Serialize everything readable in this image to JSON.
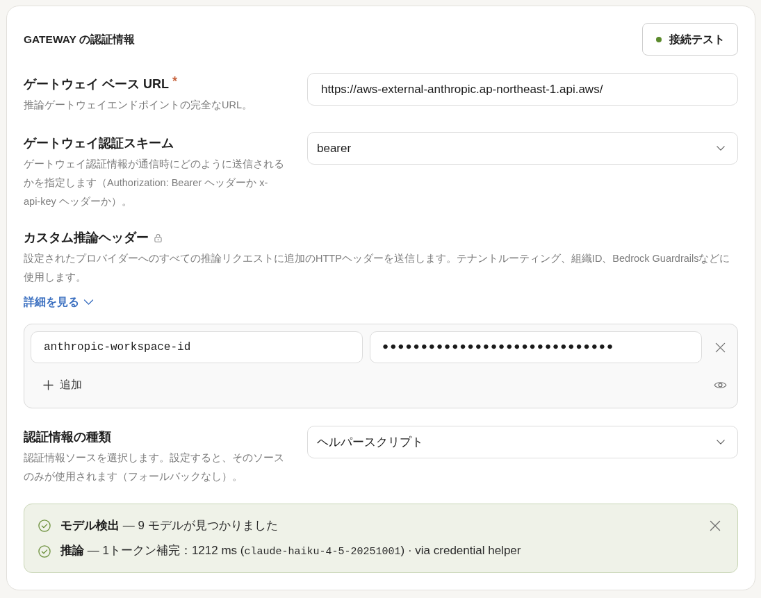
{
  "title": "GATEWAY の認証情報",
  "test_button": {
    "label": "接続テスト"
  },
  "sections": [
    {
      "kind": "input",
      "label": "ゲートウェイ ベース URL",
      "required_mark": "*",
      "description": "推論ゲートウェイエンドポイントの完全なURL。",
      "value": "https://aws-external-anthropic.ap-northeast-1.api.aws/"
    },
    {
      "kind": "select",
      "label": "ゲートウェイ認証スキーム",
      "description": "ゲートウェイ認証情報が通信時にどのように送信されるかを指定します（Authorization: Bearer ヘッダーか x-api-key ヘッダーか）。",
      "value": "bearer"
    },
    {
      "kind": "headers",
      "label": "カスタム推論ヘッダー",
      "locked": true,
      "description": "設定されたプロバイダーへのすべての推論リクエストに追加のHTTPヘッダーを送信します。テナントルーティング、組織ID、Bedrock Guardrailsなどに使用します。",
      "details_link": {
        "label": "詳細を見る",
        "expanded": false
      },
      "headers": [
        {
          "key": "anthropic-workspace-id",
          "value": "••••••••••••••••••••••••••••••"
        }
      ],
      "add_button": "追加"
    },
    {
      "kind": "select",
      "label": "認証情報の種類",
      "description": "認証情報ソースを選択します。設定すると、そのソースのみが使用されます（フォールバックなし）。",
      "value": "ヘルパースクリプト"
    }
  ],
  "results": [
    {
      "segments": [
        {
          "kind": "bold",
          "text": "モデル検出"
        },
        {
          "kind": "text",
          "text": " — 9 モデルが見つかりました"
        }
      ]
    },
    {
      "segments": [
        {
          "kind": "bold",
          "text": "推論"
        },
        {
          "kind": "text",
          "text": " — 1トークン補完：1212 ms ("
        },
        {
          "kind": "code",
          "text": "claude-haiku-4-5-20251001"
        },
        {
          "kind": "text",
          "text": ") · via credential helper"
        }
      ]
    }
  ]
}
